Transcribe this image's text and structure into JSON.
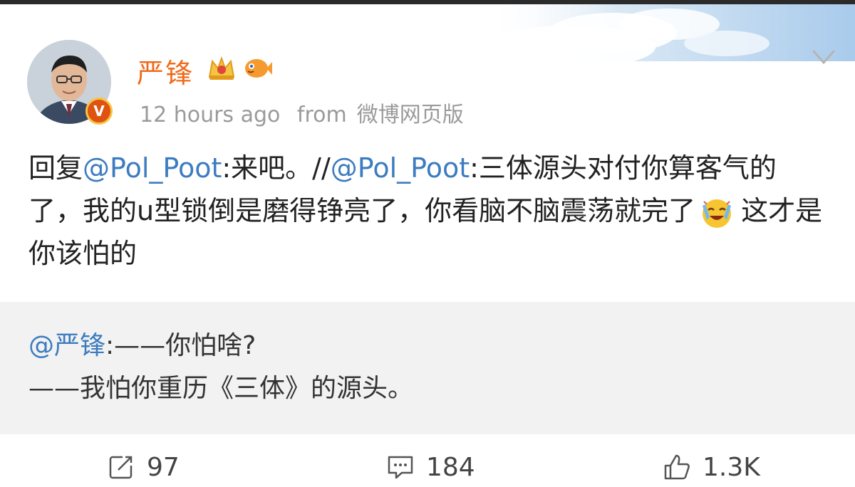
{
  "post": {
    "author": "严锋",
    "timestamp": "12 hours ago",
    "source_prefix": "from",
    "source": "微博网页版",
    "avatar_badge": "V",
    "icons": [
      "crown-badge-icon",
      "fish-badge-icon",
      "verified-v-icon",
      "chevron-down-icon"
    ],
    "text_parts": {
      "reply_prefix": "回复",
      "mention1": "@Pol_Poot",
      "after1": ":来吧。//",
      "mention2": "@Pol_Poot",
      "body": ":三体源头对付你算客气的了，我的u型锁倒是磨得铮亮了，你看脑不脑震荡就完了",
      "tail": "这才是你该怕的"
    }
  },
  "repost": {
    "mention": "@严锋",
    "line1_rest": ":——你怕啥?",
    "line2": "——我怕你重历《三体》的源头。"
  },
  "actions": {
    "repost_count": "97",
    "comment_count": "184",
    "like_count": "1.3K"
  },
  "colors": {
    "username": "#f16a1b",
    "mention": "#3d7cc0",
    "meta": "#9a9a9a",
    "repost_bg": "#f2f2f2"
  }
}
